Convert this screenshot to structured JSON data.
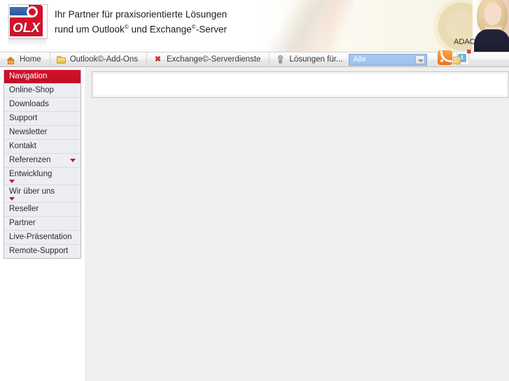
{
  "header": {
    "logo_text": "OLX",
    "logo_alt": "olx-logo",
    "tagline_line1_a": "Ihr Partner für praxisorientierte Lösungen",
    "tagline_line2_a": "rund um Outlook",
    "tagline_sup1": "©",
    "tagline_line2_b": " und Exchange",
    "tagline_sup2": "©",
    "tagline_line2_c": "-Server",
    "partner_text": "ADAC V",
    "social": {
      "rss": "rss-icon",
      "twitter": "twitter-icon"
    }
  },
  "tabbar": {
    "tabs": [
      {
        "label": "Home",
        "icon": "home-icon"
      },
      {
        "label": "Outlook©-Add-Ons",
        "icon": "folder-icon"
      },
      {
        "label": "Exchange©-Serverdienste",
        "icon": "exchange-icon"
      },
      {
        "label": "Lösungen für...",
        "icon": "lightbulb-icon"
      }
    ],
    "filter": {
      "selected": "Alle",
      "options": [
        "Alle"
      ]
    }
  },
  "sidebar": {
    "title": "Navigation",
    "items": [
      {
        "label": "Online-Shop",
        "arrow": "none"
      },
      {
        "label": "Downloads",
        "arrow": "none"
      },
      {
        "label": "Support",
        "arrow": "none"
      },
      {
        "label": "Newsletter",
        "arrow": "none"
      },
      {
        "label": "Kontakt",
        "arrow": "none"
      },
      {
        "label": "Referenzen",
        "arrow": "right"
      },
      {
        "label": "Entwicklung",
        "arrow": "wrap"
      },
      {
        "label": "Wir über uns",
        "arrow": "wrap"
      },
      {
        "label": "Reseller",
        "arrow": "none"
      },
      {
        "label": "Partner",
        "arrow": "none"
      },
      {
        "label": "Live-Präsentation",
        "arrow": "none"
      },
      {
        "label": "Remote-Support",
        "arrow": "none"
      }
    ]
  },
  "main": {
    "notice_box_text": ""
  },
  "colors": {
    "brand_red": "#cc0f26",
    "sidebar_bg": "#eceef3",
    "content_bg": "#efefef",
    "select_blue": "#a6c9f0"
  }
}
